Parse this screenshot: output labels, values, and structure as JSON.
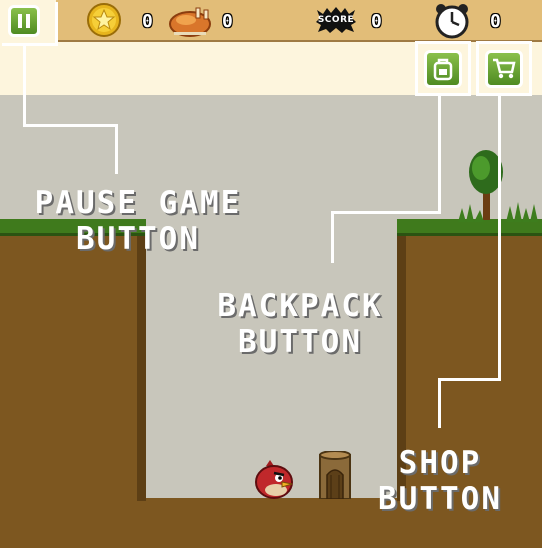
{
  "hud": {
    "coins": "0",
    "food": "0",
    "score_badge_text": "SCORE",
    "score": "0",
    "time": "0"
  },
  "icons": {
    "pause": "pause-icon",
    "coin": "coin-icon",
    "food": "roast-chicken-icon",
    "score": "score-badge-icon",
    "timer": "alarm-clock-icon",
    "backpack": "backpack-icon",
    "shop": "shopping-cart-icon"
  },
  "callouts": {
    "pause": "PAUSE GAME\nBUTTON",
    "backpack": "BACKPACK\nBUTTON",
    "shop": "SHOP\nBUTTON"
  },
  "colors": {
    "button_green": "#6aa534",
    "dirt": "#7d5720",
    "grass": "#3f7a1c",
    "sky": "#c8c6bb",
    "topbar": "#e2bd78",
    "bird_red": "#c0282b"
  }
}
